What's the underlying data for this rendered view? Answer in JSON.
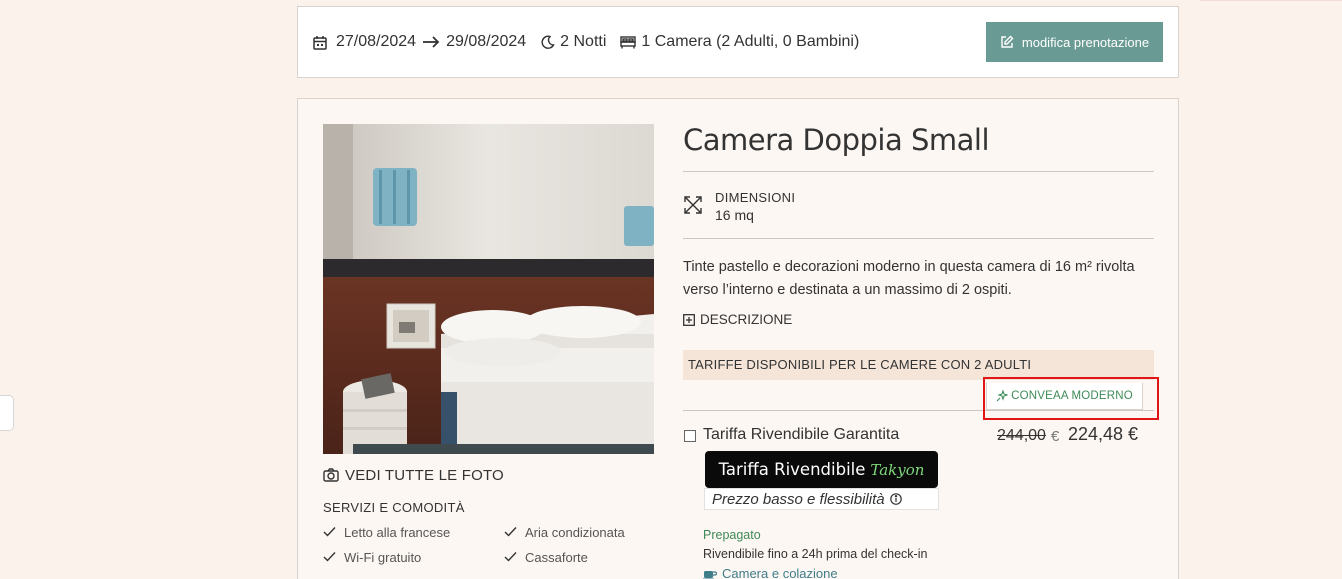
{
  "booking": {
    "checkin": "27/08/2024",
    "checkout": "29/08/2024",
    "nights": "2 Notti",
    "rooms": "1 Camera (2 Adulti, 0 Bambini)",
    "edit_label": "modifica prenotazione"
  },
  "room": {
    "title": "Camera Doppia Small",
    "dimension_label": "DIMENSIONI",
    "dimension_value": "16 mq",
    "description": "Tinte pastello e decorazioni moderno in questa camera di 16 m² rivolta verso l’interno e destinata a un massimo di 2 ospiti.",
    "description_toggle": "DESCRIZIONE",
    "photos_label": "VEDI TUTTE LE FOTO",
    "services_title": "SERVIZI E COMODITÀ",
    "amenities": [
      "Letto alla francese",
      "Aria condizionata",
      "Wi-Fi gratuito",
      "Cassaforte"
    ]
  },
  "tariffs": {
    "header": "TARIFFE DISPONIBILI PER LE CAMERE CON 2 ADULTI",
    "promo_tag": "CONVEAA MODERNO",
    "name": "Tariffa Rivendibile Garantita",
    "old_price": "244,00",
    "currency": "€",
    "new_price": "224,48 €",
    "badge_text": "Tariffa Rivendibile",
    "badge_brand": "Takyon",
    "badge_sub": "Prezzo basso e flessibilità",
    "prepaid": "Prepagato",
    "refundable": "Rivendibile fino a 24h prima del check-in",
    "meal": "Camera e colazione"
  },
  "icons": {
    "calendar": "calendar-icon",
    "arrow": "arrow-right-icon",
    "moon": "moon-icon",
    "bed": "bed-icon",
    "edit": "edit-icon",
    "camera": "camera-icon",
    "expand": "expand-icon",
    "plus": "plus-square-icon",
    "promo": "sparkle-icon",
    "info": "info-icon",
    "coffee": "coffee-icon"
  },
  "colors": {
    "page_bg": "#fcf2ec",
    "accent": "#6a9a94",
    "promo_green": "#3f8a58",
    "tariff_header_bg": "#f5e4d8",
    "highlight": "#e01616"
  }
}
